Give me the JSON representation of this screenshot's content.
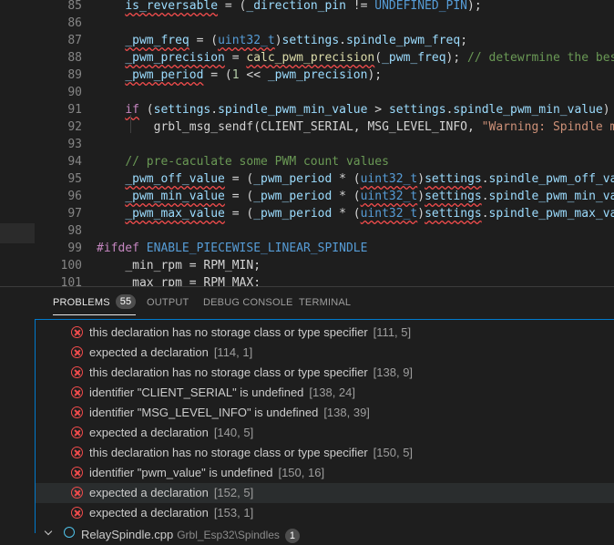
{
  "editor": {
    "lines": [
      {
        "num": "85",
        "segs": [
          {
            "t": "    "
          },
          {
            "t": "is_reversable",
            "c": "t-var sq"
          },
          {
            "t": " = ("
          },
          {
            "t": "_direction_pin",
            "c": "t-var"
          },
          {
            "t": " != "
          },
          {
            "t": "UNDEFINED_PIN",
            "c": "t-macro"
          },
          {
            "t": ");"
          }
        ]
      },
      {
        "num": "86",
        "segs": []
      },
      {
        "num": "87",
        "segs": [
          {
            "t": "    "
          },
          {
            "t": "_pwm_freq",
            "c": "t-var sq"
          },
          {
            "t": " = ("
          },
          {
            "t": "uint32_t",
            "c": "t-typebad sq"
          },
          {
            "t": ")"
          },
          {
            "t": "settings",
            "c": "t-var"
          },
          {
            "t": "."
          },
          {
            "t": "spindle_pwm_freq",
            "c": "t-var"
          },
          {
            "t": ";"
          }
        ]
      },
      {
        "num": "88",
        "segs": [
          {
            "t": "    "
          },
          {
            "t": "_pwm_precision",
            "c": "t-var sq"
          },
          {
            "t": " = "
          },
          {
            "t": "calc_pwm_precision",
            "c": "t-fn sq"
          },
          {
            "t": "("
          },
          {
            "t": "_pwm_freq",
            "c": "t-var"
          },
          {
            "t": "); "
          },
          {
            "t": "// detewrmine the best",
            "c": "t-com"
          }
        ]
      },
      {
        "num": "89",
        "segs": [
          {
            "t": "    "
          },
          {
            "t": "_pwm_period",
            "c": "t-var sq"
          },
          {
            "t": " = ("
          },
          {
            "t": "1",
            "c": "t-num"
          },
          {
            "t": " << "
          },
          {
            "t": "_pwm_precision",
            "c": "t-var"
          },
          {
            "t": ");"
          }
        ]
      },
      {
        "num": "90",
        "segs": []
      },
      {
        "num": "91",
        "segs": [
          {
            "t": "    "
          },
          {
            "t": "if",
            "c": "t-kw sq"
          },
          {
            "t": " ("
          },
          {
            "t": "settings",
            "c": "t-var"
          },
          {
            "t": "."
          },
          {
            "t": "spindle_pwm_min_value",
            "c": "t-var"
          },
          {
            "t": " > "
          },
          {
            "t": "settings",
            "c": "t-var"
          },
          {
            "t": "."
          },
          {
            "t": "spindle_pwm_min_value",
            "c": "t-var"
          },
          {
            "t": ")"
          }
        ]
      },
      {
        "num": "92",
        "segs": [
          {
            "t": "        "
          },
          {
            "t": "grbl_msg_sendf",
            "c": "t-dim"
          },
          {
            "t": "("
          },
          {
            "t": "CLIENT_SERIAL",
            "c": "t-dim"
          },
          {
            "t": ", "
          },
          {
            "t": "MSG_LEVEL_INFO",
            "c": "t-dim"
          },
          {
            "t": ", "
          },
          {
            "t": "\"Warning: Spindle mi",
            "c": "t-str"
          }
        ]
      },
      {
        "num": "93",
        "segs": []
      },
      {
        "num": "94",
        "segs": [
          {
            "t": "    "
          },
          {
            "t": "// pre-caculate some PWM count values",
            "c": "t-com"
          }
        ]
      },
      {
        "num": "95",
        "segs": [
          {
            "t": "    "
          },
          {
            "t": "_pwm_off_value",
            "c": "t-var sq"
          },
          {
            "t": " = ("
          },
          {
            "t": "_pwm_period",
            "c": "t-var"
          },
          {
            "t": " * ("
          },
          {
            "t": "uint32_t",
            "c": "t-typebad sq"
          },
          {
            "t": ")"
          },
          {
            "t": "settings",
            "c": "t-var sq"
          },
          {
            "t": "."
          },
          {
            "t": "spindle_pwm_off_val",
            "c": "t-var"
          }
        ]
      },
      {
        "num": "96",
        "segs": [
          {
            "t": "    "
          },
          {
            "t": "_pwm_min_value",
            "c": "t-var sq"
          },
          {
            "t": " = ("
          },
          {
            "t": "_pwm_period",
            "c": "t-var"
          },
          {
            "t": " * ("
          },
          {
            "t": "uint32_t",
            "c": "t-typebad sq"
          },
          {
            "t": ")"
          },
          {
            "t": "settings",
            "c": "t-var sq"
          },
          {
            "t": "."
          },
          {
            "t": "spindle_pwm_min_val",
            "c": "t-var"
          }
        ]
      },
      {
        "num": "97",
        "segs": [
          {
            "t": "    "
          },
          {
            "t": "_pwm_max_value",
            "c": "t-var sq"
          },
          {
            "t": " = ("
          },
          {
            "t": "_pwm_period",
            "c": "t-var"
          },
          {
            "t": " * ("
          },
          {
            "t": "uint32_t",
            "c": "t-typebad sq"
          },
          {
            "t": ")"
          },
          {
            "t": "settings",
            "c": "t-var sq"
          },
          {
            "t": "."
          },
          {
            "t": "spindle_pwm_max_val",
            "c": "t-var"
          }
        ]
      },
      {
        "num": "98",
        "segs": []
      },
      {
        "num": "99",
        "segs": [
          {
            "t": "#ifdef",
            "c": "t-dir"
          },
          {
            "t": " "
          },
          {
            "t": "ENABLE_PIECEWISE_LINEAR_SPINDLE",
            "c": "t-macro"
          }
        ]
      },
      {
        "num": "100",
        "segs": [
          {
            "t": "    "
          },
          {
            "t": "_min_rpm",
            "c": "t-dim"
          },
          {
            "t": " = "
          },
          {
            "t": "RPM_MIN",
            "c": "t-dim"
          },
          {
            "t": ";"
          }
        ]
      },
      {
        "num": "101",
        "segs": [
          {
            "t": "    "
          },
          {
            "t": "_max_rpm",
            "c": "t-dim"
          },
          {
            "t": " = "
          },
          {
            "t": "RPM_MAX",
            "c": "t-dim"
          },
          {
            "t": ";"
          }
        ]
      }
    ]
  },
  "panel": {
    "tabs": [
      {
        "label": "PROBLEMS",
        "active": true,
        "badge": "55"
      },
      {
        "label": "OUTPUT"
      },
      {
        "label": "DEBUG CONSOLE"
      },
      {
        "label": "TERMINAL"
      }
    ],
    "problems": [
      {
        "msg": "this declaration has no storage class or type specifier",
        "loc": "[111, 5]"
      },
      {
        "msg": "expected a declaration",
        "loc": "[114, 1]"
      },
      {
        "msg": "this declaration has no storage class or type specifier",
        "loc": "[138, 9]"
      },
      {
        "msg": "identifier \"CLIENT_SERIAL\" is undefined",
        "loc": "[138, 24]"
      },
      {
        "msg": "identifier \"MSG_LEVEL_INFO\" is undefined",
        "loc": "[138, 39]"
      },
      {
        "msg": "expected a declaration",
        "loc": "[140, 5]"
      },
      {
        "msg": "this declaration has no storage class or type specifier",
        "loc": "[150, 5]"
      },
      {
        "msg": "identifier \"pwm_value\" is undefined",
        "loc": "[150, 16]"
      },
      {
        "msg": "expected a declaration",
        "loc": "[152, 5]",
        "selected": true
      },
      {
        "msg": "expected a declaration",
        "loc": "[153, 1]"
      }
    ],
    "next_file": {
      "name": "RelaySpindle.cpp",
      "path": "Grbl_Esp32\\Spindles",
      "count": "1"
    }
  }
}
